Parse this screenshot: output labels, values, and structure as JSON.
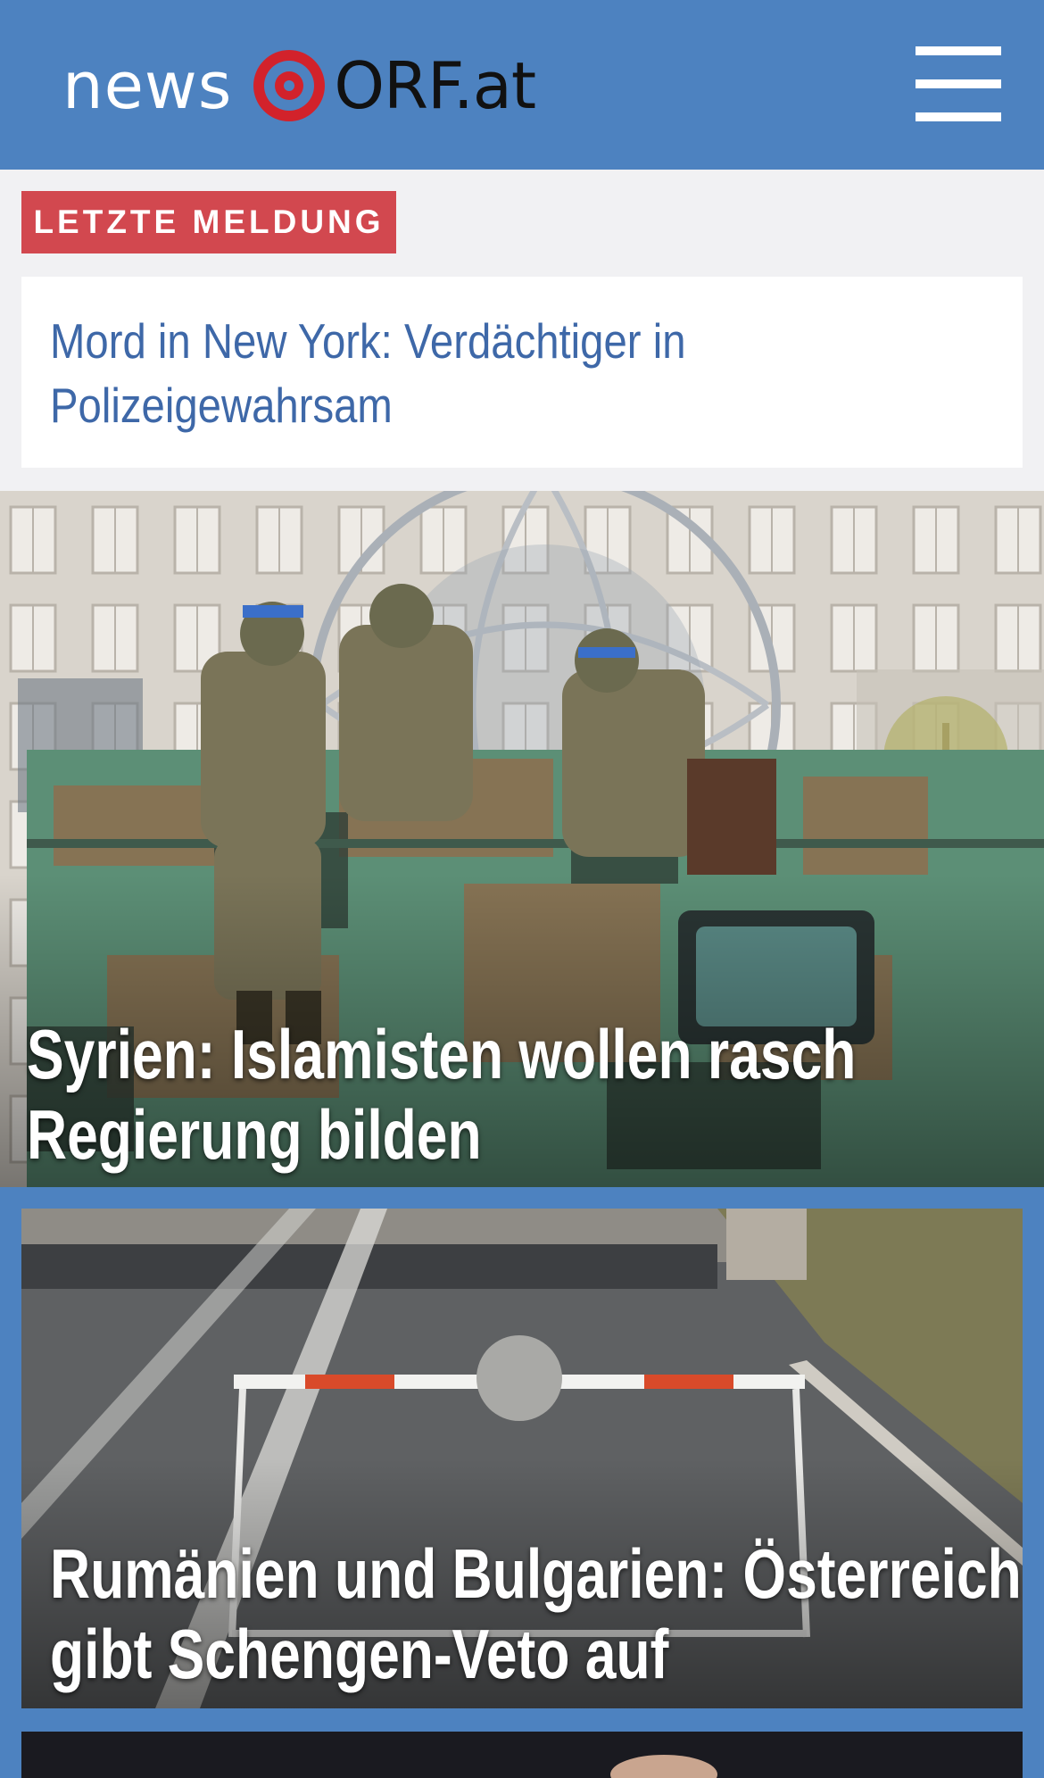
{
  "header": {
    "logo_news": "news",
    "logo_orf": "ORF.at",
    "menu_icon": "hamburger-menu-icon",
    "brand_color": "#4d82c0",
    "accent_color": "#d2222b"
  },
  "breaking": {
    "badge": "LETZTE MELDUNG",
    "headline_line1": "Mord in New York: Verdächtiger in",
    "headline_line2": "Polizeigewahrsam",
    "badge_color": "#d2484f",
    "headline_color": "#3e68a8"
  },
  "stories": [
    {
      "title_line1": "Syrien: Islamisten wollen rasch",
      "title_line2": "Regierung bilden"
    },
    {
      "title_line1": "Rumänien und Bulgarien: Österreich",
      "title_line2": "gibt Schengen-Veto auf"
    }
  ]
}
